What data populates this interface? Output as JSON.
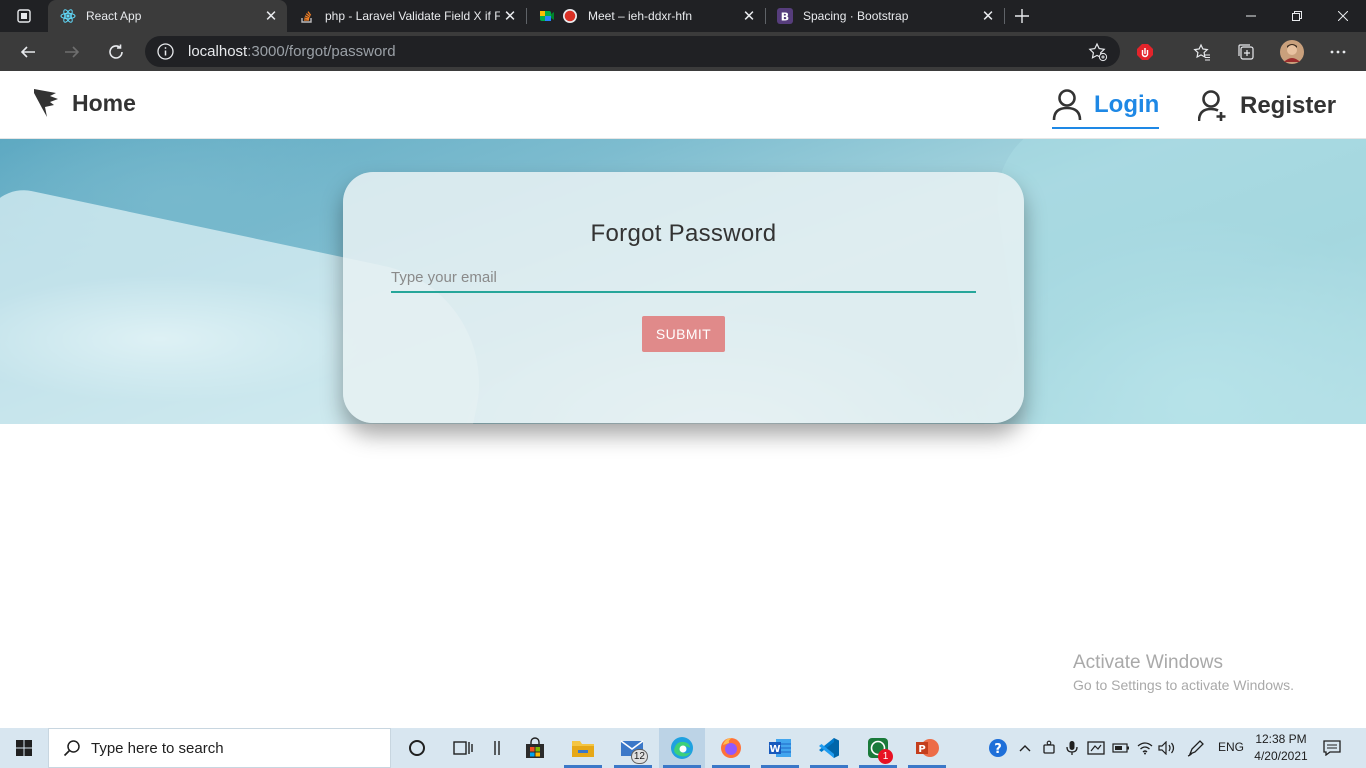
{
  "browser": {
    "tabs": [
      {
        "title": "React App",
        "icon": "react-icon",
        "active": true
      },
      {
        "title": "php - Laravel Validate Field X if F",
        "icon": "stackoverflow-icon",
        "active": false
      },
      {
        "title": "Meet – ieh-ddxr-hfn",
        "icon": "meet-icon",
        "active": false
      },
      {
        "title": "Spacing · Bootstrap",
        "icon": "bootstrap-icon",
        "active": false
      }
    ],
    "url_host": "localhost",
    "url_path": ":3000/forgot/password"
  },
  "navbar": {
    "brand_label": "Home",
    "login_label": "Login",
    "register_label": "Register"
  },
  "form": {
    "title": "Forgot Password",
    "email_placeholder": "Type your email",
    "email_value": "",
    "submit_label": "SUBMIT"
  },
  "watermark": {
    "title": "Activate Windows",
    "subtitle": "Go to Settings to activate Windows."
  },
  "taskbar": {
    "search_placeholder": "Type here to search",
    "mail_badge": "12",
    "whatsapp_badge": "1",
    "language": "ENG",
    "time": "12:38 PM",
    "date": "4/20/2021"
  },
  "colors": {
    "accent": "#1e88e5",
    "input_underline": "#26a69a",
    "submit_button": "#e08a8a"
  }
}
